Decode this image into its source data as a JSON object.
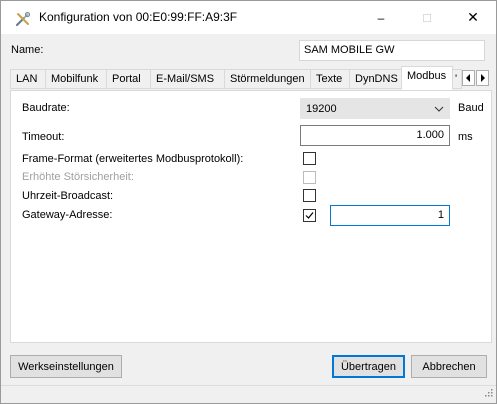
{
  "window": {
    "title": "Konfiguration von 00:E0:99:FF:A9:3F",
    "minimize_symbol": "–",
    "maximize_symbol": "□",
    "close_symbol": "✕"
  },
  "name": {
    "label": "Name:",
    "value": "SAM MOBILE GW"
  },
  "tabs": [
    {
      "label": "LAN"
    },
    {
      "label": "Mobilfunk"
    },
    {
      "label": "Portal"
    },
    {
      "label": "E-Mail/SMS"
    },
    {
      "label": "Störmeldungen"
    },
    {
      "label": "Texte"
    },
    {
      "label": "DynDNS"
    },
    {
      "label": "Modbus",
      "active": true
    },
    {
      "label": "'"
    }
  ],
  "modbus": {
    "baudrate": {
      "label": "Baudrate:",
      "value": "19200",
      "unit": "Baud"
    },
    "timeout": {
      "label": "Timeout:",
      "value": "1.000",
      "unit": "ms"
    },
    "frame_format": {
      "label": "Frame-Format (erweitertes Modbusprotokoll):",
      "checked": false
    },
    "stoersicherheit": {
      "label": "Erhöhte Störsicherheit:",
      "checked": false,
      "disabled": true
    },
    "uhrzeit_broadcast": {
      "label": "Uhrzeit-Broadcast:",
      "checked": false
    },
    "gateway_adresse": {
      "label": "Gateway-Adresse:",
      "checked": true,
      "value": "1"
    }
  },
  "buttons": {
    "werkseinstellungen": "Werkseinstellungen",
    "uebertragen": "Übertragen",
    "abbrechen": "Abbrechen"
  },
  "icons": {
    "app": "tools-icon",
    "chevron": "chevron-down-icon",
    "tab_left": "arrow-left-icon",
    "tab_right": "arrow-right-icon"
  }
}
